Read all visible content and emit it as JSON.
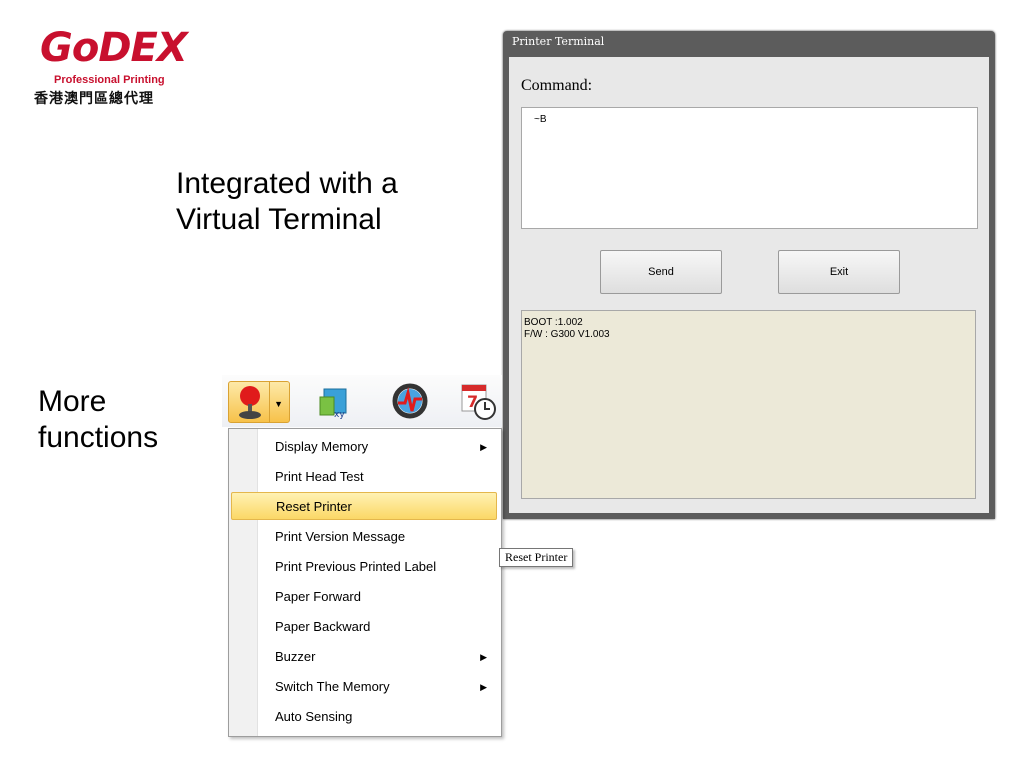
{
  "logo": {
    "wordmark": "GoDEX",
    "tagline": "Professional Printing",
    "chinese": "香港澳門區總代理"
  },
  "captions": {
    "virtual_terminal": "Integrated with a Virtual Terminal",
    "more_functions": "More functions"
  },
  "terminal": {
    "title": "Printer Terminal",
    "command_label": "Command:",
    "command_value": "~B",
    "send_label": "Send",
    "exit_label": "Exit",
    "output_lines": [
      "BOOT :1.002",
      "F/W : G300 V1.003"
    ]
  },
  "toolbar": {
    "icons": [
      "printer-tool-icon",
      "label-xy-icon",
      "monitor-icon",
      "calendar-clock-icon"
    ]
  },
  "menu": {
    "items": [
      {
        "label": "Display Memory",
        "submenu": true
      },
      {
        "label": "Print Head Test",
        "submenu": false
      },
      {
        "label": "Reset Printer",
        "submenu": false,
        "highlighted": true
      },
      {
        "label": "Print Version Message",
        "submenu": false
      },
      {
        "label": "Print Previous Printed Label",
        "submenu": false
      },
      {
        "label": "Paper Forward",
        "submenu": false
      },
      {
        "label": "Paper Backward",
        "submenu": false
      },
      {
        "label": "Buzzer",
        "submenu": true
      },
      {
        "label": "Switch The Memory",
        "submenu": true
      },
      {
        "label": "Auto Sensing",
        "submenu": false
      }
    ]
  },
  "tooltip": "Reset Printer",
  "colors": {
    "brand": "#c8102e",
    "highlight": "#fbd866"
  }
}
